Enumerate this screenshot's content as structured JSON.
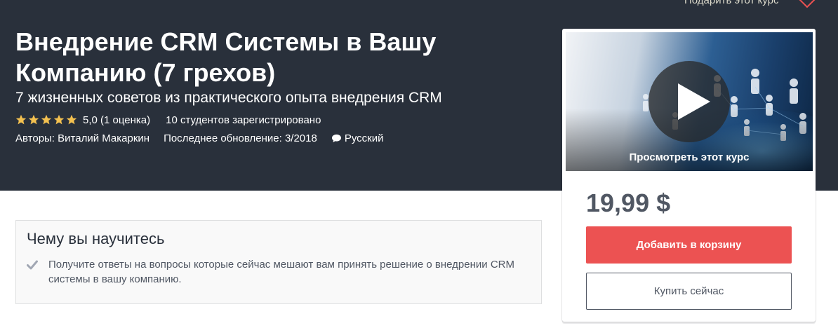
{
  "header": {
    "gift_link": "Подарить этот курс",
    "title": "Внедрение CRM Системы в Вашу Компанию (7 грехов)",
    "subtitle": "7 жизненных советов из практического опыта внедрения CRM",
    "rating": {
      "stars": 5,
      "value_text": "5,0 (1 оценка)",
      "students": "10 студентов зарегистрировано"
    },
    "authors": "Авторы: Виталий Макаркин",
    "updated": "Последнее обновление: 3/2018",
    "language": "Русский"
  },
  "sidebar": {
    "preview_label": "Просмотреть этот курс",
    "price": "19,99 $",
    "add_to_cart": "Добавить в корзину",
    "buy_now": "Купить сейчас"
  },
  "learn": {
    "title": "Чему вы научитесь",
    "items": [
      "Получите ответы на вопросы которые сейчас мешают вам принять решение о внедрении CRM системы в вашу компанию."
    ]
  },
  "colors": {
    "hero_bg": "#29303b",
    "star": "#f4c150",
    "cart_button": "#ec5252",
    "gift_heart": "#ec5252"
  },
  "icons": [
    "star-icon",
    "heart-icon",
    "speech-bubble-icon",
    "play-icon",
    "check-icon"
  ]
}
